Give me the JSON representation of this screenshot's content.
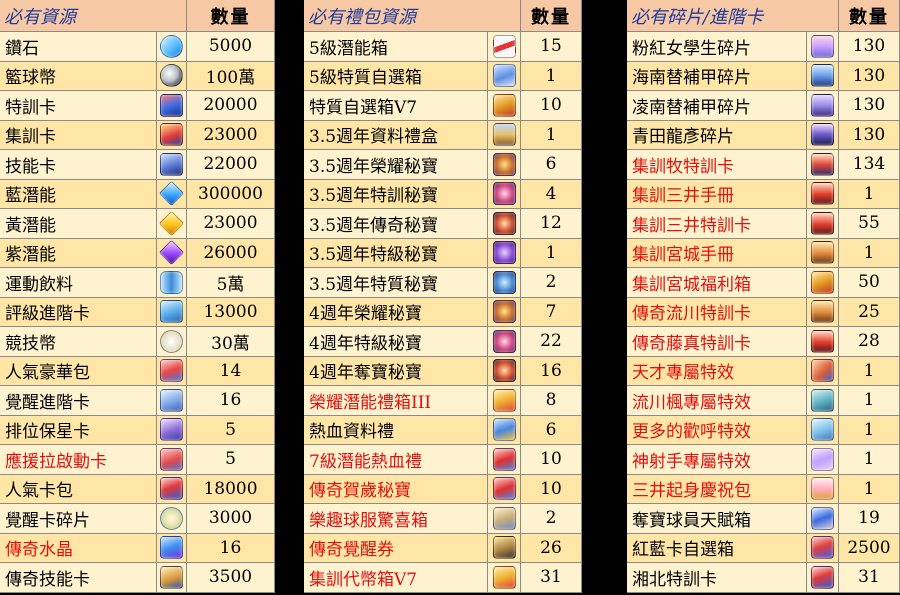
{
  "colors": {
    "header_bg": "#f7c8a4",
    "row_bg_a": "#ffe6a6",
    "row_bg_b": "#fff3cf",
    "header_text": "#1f3a9a",
    "highlight_text": "#e01010",
    "gap": "#000000"
  },
  "table1": {
    "header_name": "必有資源",
    "header_qty": "數量",
    "rows": [
      {
        "name": "鑽石",
        "qty": "5000",
        "icon": "diamond-icon"
      },
      {
        "name": "籃球幣",
        "qty": "100萬",
        "icon": "basketball-coin-icon"
      },
      {
        "name": "特訓卡",
        "qty": "20000",
        "icon": "special-training-card-icon"
      },
      {
        "name": "集訓卡",
        "qty": "23000",
        "icon": "camp-training-card-icon"
      },
      {
        "name": "技能卡",
        "qty": "22000",
        "icon": "skill-card-icon"
      },
      {
        "name": "藍潛能",
        "qty": "300000",
        "icon": "blue-potential-gem-icon"
      },
      {
        "name": "黃潛能",
        "qty": "23000",
        "icon": "yellow-potential-gem-icon"
      },
      {
        "name": "紫潛能",
        "qty": "26000",
        "icon": "purple-potential-gem-icon"
      },
      {
        "name": "運動飲料",
        "qty": "5萬",
        "icon": "sports-drink-icon"
      },
      {
        "name": "評級進階卡",
        "qty": "13000",
        "icon": "rank-advance-card-icon"
      },
      {
        "name": "競技幣",
        "qty": "30萬",
        "icon": "arena-coin-icon"
      },
      {
        "name": "人氣豪華包",
        "qty": "14",
        "icon": "popularity-deluxe-pack-icon"
      },
      {
        "name": "覺醒進階卡",
        "qty": "16",
        "icon": "awaken-advance-card-icon"
      },
      {
        "name": "排位保星卡",
        "qty": "5",
        "icon": "rank-star-protect-card-icon"
      },
      {
        "name": "應援拉啟動卡",
        "qty": "5",
        "icon": "cheer-activation-card-icon",
        "red": true
      },
      {
        "name": "人氣卡包",
        "qty": "18000",
        "icon": "popularity-card-pack-icon"
      },
      {
        "name": "覺醒卡碎片",
        "qty": "3000",
        "icon": "awaken-card-shard-icon"
      },
      {
        "name": "傳奇水晶",
        "qty": "16",
        "icon": "legend-crystal-icon",
        "red": true
      },
      {
        "name": "傳奇技能卡",
        "qty": "3500",
        "icon": "legend-skill-card-icon"
      }
    ]
  },
  "table2": {
    "header_name": "必有禮包資源",
    "header_qty": "數量",
    "rows": [
      {
        "name": "5級潛能箱",
        "qty": "15",
        "icon": "potential-box-icon"
      },
      {
        "name": "5級特質自選箱",
        "qty": "1",
        "icon": "trait-select-box-icon"
      },
      {
        "name": "特質自選箱V7",
        "qty": "10",
        "icon": "trait-select-box-v7-icon"
      },
      {
        "name": "3.5週年資料禮盒",
        "qty": "1",
        "icon": "anniversary-gift-box-icon"
      },
      {
        "name": "3.5週年榮耀秘寶",
        "qty": "6",
        "icon": "glory-treasure-icon"
      },
      {
        "name": "3.5週年特訓秘寶",
        "qty": "4",
        "icon": "training-treasure-icon"
      },
      {
        "name": "3.5週年傳奇秘寶",
        "qty": "12",
        "icon": "legend-treasure-icon"
      },
      {
        "name": "3.5週年特級秘寶",
        "qty": "1",
        "icon": "premium-treasure-icon"
      },
      {
        "name": "3.5週年特質秘寶",
        "qty": "2",
        "icon": "trait-treasure-icon"
      },
      {
        "name": "4週年榮耀秘寶",
        "qty": "7",
        "icon": "glory-treasure-4th-icon"
      },
      {
        "name": "4週年特級秘寶",
        "qty": "22",
        "icon": "premium-treasure-4th-icon"
      },
      {
        "name": "4週年奪寶秘寶",
        "qty": "16",
        "icon": "loot-treasure-4th-icon"
      },
      {
        "name": "榮耀潛能禮箱III",
        "qty": "8",
        "icon": "glory-potential-gift-box-icon",
        "red": true
      },
      {
        "name": "熱血資料禮",
        "qty": "6",
        "icon": "hot-blood-data-gift-icon"
      },
      {
        "name": "7級潛能熱血禮",
        "qty": "10",
        "icon": "potential-hot-blood-gift-icon",
        "red": true
      },
      {
        "name": "傳奇賀歲秘寶",
        "qty": "10",
        "icon": "legend-new-year-treasure-icon",
        "red": true
      },
      {
        "name": "樂趣球服驚喜箱",
        "qty": "2",
        "icon": "jersey-surprise-box-icon",
        "red": true
      },
      {
        "name": "傳奇覺醒券",
        "qty": "26",
        "icon": "legend-awaken-ticket-icon",
        "red": true
      },
      {
        "name": "集訓代幣箱V7",
        "qty": "31",
        "icon": "camp-token-box-icon",
        "red": true
      }
    ]
  },
  "table3": {
    "header_name": "必有碎片/進階卡",
    "header_qty": "數量",
    "rows": [
      {
        "name": "粉紅女學生碎片",
        "qty": "130",
        "icon": "pink-schoolgirl-shard-icon"
      },
      {
        "name": "海南替補甲碎片",
        "qty": "130",
        "icon": "kainan-sub-shard-icon"
      },
      {
        "name": "凌南替補甲碎片",
        "qty": "130",
        "icon": "ryonan-sub-shard-icon"
      },
      {
        "name": "青田龍彥碎片",
        "qty": "130",
        "icon": "aota-shard-icon"
      },
      {
        "name": "集訓牧特訓卡",
        "qty": "134",
        "icon": "maki-training-card-icon",
        "red": true
      },
      {
        "name": "集訓三井手冊",
        "qty": "1",
        "icon": "mitsui-handbook-icon",
        "red": true
      },
      {
        "name": "集訓三井特訓卡",
        "qty": "55",
        "icon": "mitsui-training-card-icon",
        "red": true
      },
      {
        "name": "集訓宮城手冊",
        "qty": "1",
        "icon": "miyagi-handbook-icon",
        "red": true
      },
      {
        "name": "集訓宮城福利箱",
        "qty": "50",
        "icon": "miyagi-welfare-box-icon",
        "red": true
      },
      {
        "name": "傳奇流川特訓卡",
        "qty": "25",
        "icon": "rukawa-training-card-icon",
        "red": true
      },
      {
        "name": "傳奇藤真特訓卡",
        "qty": "28",
        "icon": "fujima-training-card-icon",
        "red": true
      },
      {
        "name": "天才專屬特效",
        "qty": "1",
        "icon": "genius-effect-icon",
        "red": true
      },
      {
        "name": "流川楓專屬特效",
        "qty": "1",
        "icon": "rukawa-effect-icon",
        "red": true
      },
      {
        "name": "更多的歡呼特效",
        "qty": "1",
        "icon": "more-cheers-effect-icon",
        "red": true
      },
      {
        "name": "神射手專屬特效",
        "qty": "1",
        "icon": "sharpshooter-effect-icon",
        "red": true
      },
      {
        "name": "三井起身慶祝包",
        "qty": "1",
        "icon": "mitsui-celebration-pack-icon",
        "red": true
      },
      {
        "name": "奪寶球員天賦箱",
        "qty": "19",
        "icon": "player-talent-box-icon"
      },
      {
        "name": "紅藍卡自選箱",
        "qty": "2500",
        "icon": "red-blue-card-box-icon"
      },
      {
        "name": "湘北特訓卡",
        "qty": "31",
        "icon": "shohoku-training-card-icon"
      }
    ]
  }
}
